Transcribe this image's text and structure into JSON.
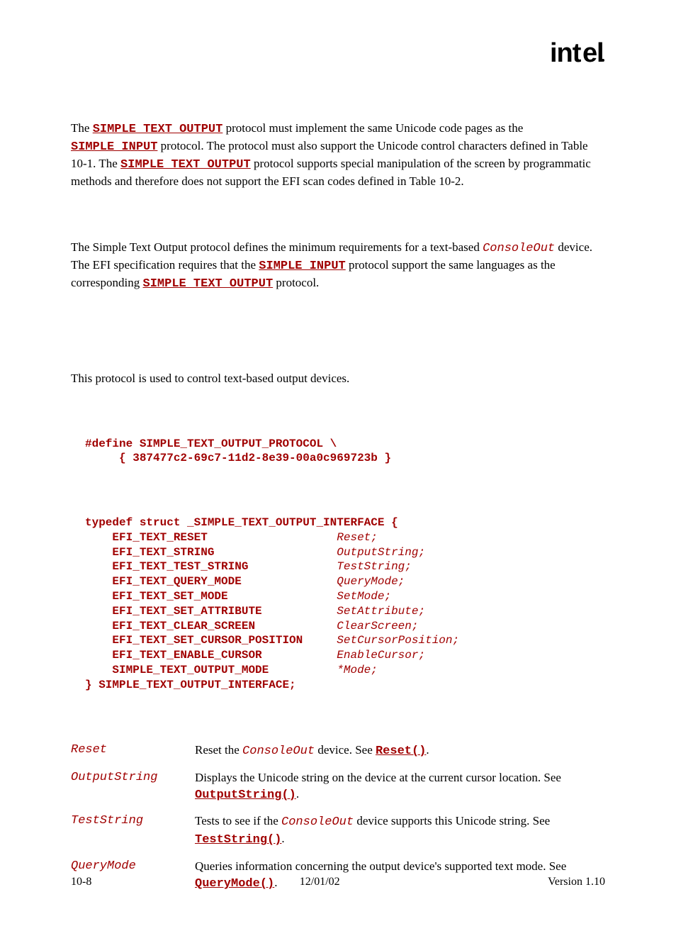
{
  "logo_text": "intel",
  "para1_parts": [
    {
      "t": "The "
    },
    {
      "t": "SIMPLE_TEXT_OUTPUT",
      "cls": "code-red"
    },
    {
      "t": " protocol must implement the same Unicode code pages as the "
    },
    {
      "t": "SIMPLE_INPUT",
      "cls": "code-red"
    },
    {
      "t": " protocol.  The protocol must also support the Unicode control characters defined in Table 10-1.  The "
    },
    {
      "t": "SIMPLE_TEXT_OUTPUT",
      "cls": "code-red"
    },
    {
      "t": " protocol supports special manipulation of the screen by programmatic methods and therefore does not support the EFI scan codes defined in Table 10-2."
    }
  ],
  "para2_parts": [
    {
      "t": "The Simple Text Output protocol defines the minimum requirements for a text-based "
    },
    {
      "t": "ConsoleOut",
      "cls": "code-red-it"
    },
    {
      "t": " device.  The EFI specification requires that the "
    },
    {
      "t": "SIMPLE_INPUT",
      "cls": "code-red"
    },
    {
      "t": " protocol support the same languages as the corresponding "
    },
    {
      "t": "SIMPLE_TEXT_OUTPUT",
      "cls": "code-red"
    },
    {
      "t": " protocol."
    }
  ],
  "para3": "This protocol is used to control text-based output devices.",
  "guid_def": "#define SIMPLE_TEXT_OUTPUT_PROTOCOL \\\n     { 387477c2-69c7-11d2-8e39-00a0c969723b }",
  "struct_open": "typedef struct _SIMPLE_TEXT_OUTPUT_INTERFACE {",
  "struct_rows": [
    {
      "type": "EFI_TEXT_RESET",
      "member": "Reset;"
    },
    {
      "type": "EFI_TEXT_STRING",
      "member": "OutputString;"
    },
    {
      "type": "EFI_TEXT_TEST_STRING",
      "member": "TestString;"
    },
    {
      "type": "EFI_TEXT_QUERY_MODE",
      "member": "QueryMode;"
    },
    {
      "type": "EFI_TEXT_SET_MODE",
      "member": "SetMode;"
    },
    {
      "type": "EFI_TEXT_SET_ATTRIBUTE",
      "member": "SetAttribute;"
    },
    {
      "type": "EFI_TEXT_CLEAR_SCREEN",
      "member": "ClearScreen;"
    },
    {
      "type": "EFI_TEXT_SET_CURSOR_POSITION",
      "member": "SetCursorPosition;"
    },
    {
      "type": "EFI_TEXT_ENABLE_CURSOR",
      "member": "EnableCursor;"
    },
    {
      "type": "SIMPLE_TEXT_OUTPUT_MODE",
      "member": "*Mode;"
    }
  ],
  "struct_close": "} SIMPLE_TEXT_OUTPUT_INTERFACE;",
  "params": [
    {
      "name": "Reset",
      "desc_parts": [
        {
          "t": "Reset the "
        },
        {
          "t": "ConsoleOut",
          "cls": "code-red-it"
        },
        {
          "t": " device.  See "
        },
        {
          "t": "Reset()",
          "cls": "code-red"
        },
        {
          "t": "."
        }
      ]
    },
    {
      "name": "OutputString",
      "desc_parts": [
        {
          "t": "Displays the Unicode string on the device at the current cursor location. See "
        },
        {
          "t": "OutputString()",
          "cls": "code-red"
        },
        {
          "t": "."
        }
      ]
    },
    {
      "name": "TestString",
      "desc_parts": [
        {
          "t": "Tests to see if the "
        },
        {
          "t": "ConsoleOut",
          "cls": "code-red-it"
        },
        {
          "t": " device supports this Unicode string. See "
        },
        {
          "t": "TestString()",
          "cls": "code-red"
        },
        {
          "t": "."
        }
      ]
    },
    {
      "name": "QueryMode",
      "desc_parts": [
        {
          "t": "Queries information concerning the output device's supported text mode. See "
        },
        {
          "t": "QueryMode()",
          "cls": "code-red"
        },
        {
          "t": "."
        }
      ]
    }
  ],
  "footer": {
    "left": "10-8",
    "center": "12/01/02",
    "right": "Version 1.10"
  }
}
